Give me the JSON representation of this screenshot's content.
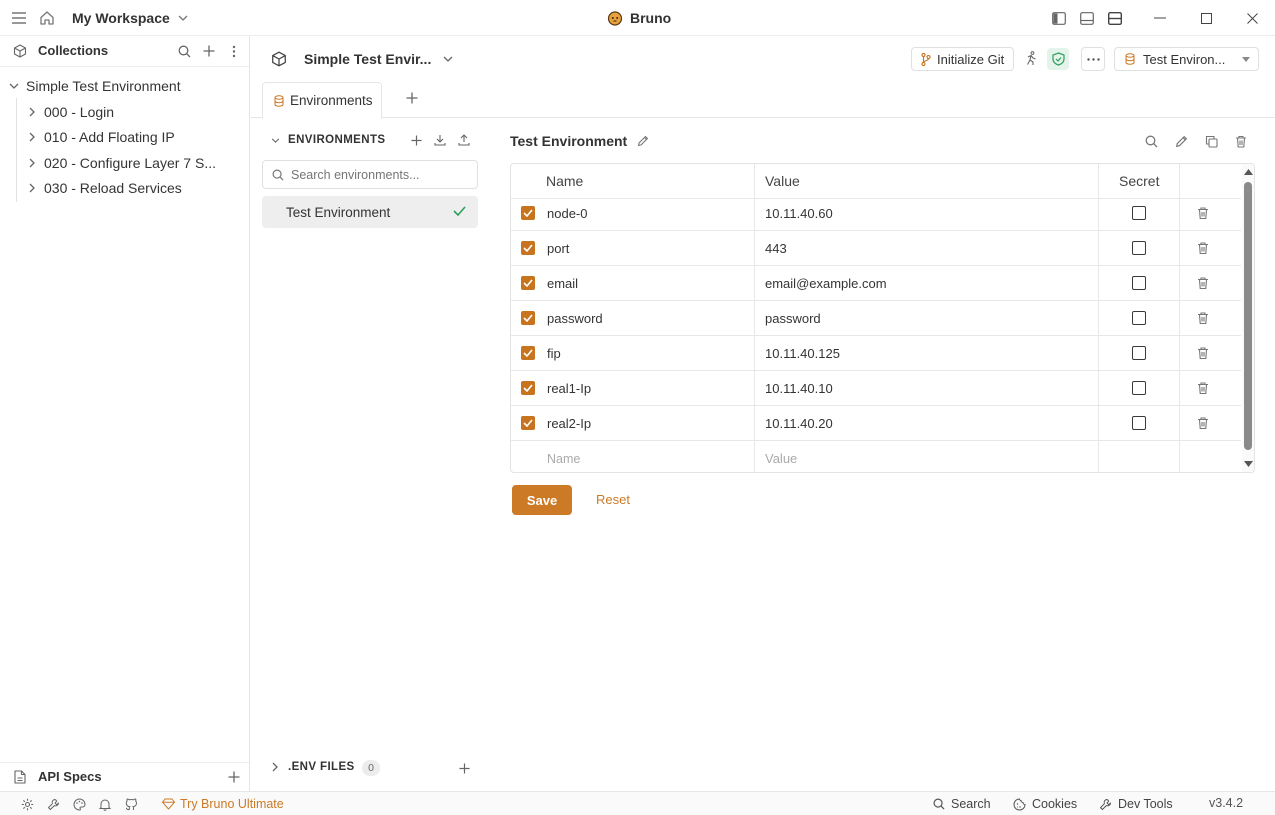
{
  "titlebar": {
    "workspace": "My Workspace",
    "app_title": "Bruno",
    "icons": [
      "menu-icon",
      "home-icon",
      "chevron-down-icon",
      "layout-left-icon",
      "layout-bottom-icon",
      "layout-split-icon",
      "minimize-icon",
      "maximize-icon",
      "close-icon"
    ]
  },
  "sidebar": {
    "collections_label": "Collections",
    "collection_name": "Simple Test Environment",
    "items": [
      {
        "label": "000 - Login"
      },
      {
        "label": "010 - Add Floating IP"
      },
      {
        "label": "020 - Configure Layer 7 S..."
      },
      {
        "label": "030 - Reload Services"
      }
    ],
    "api_specs_label": "API Specs"
  },
  "header": {
    "collection_title": "Simple Test Envir...",
    "init_git_label": "Initialize Git",
    "env_selector_label": "Test Environ..."
  },
  "tabs": [
    {
      "label": "Environments"
    }
  ],
  "environments_panel": {
    "heading": "ENVIRONMENTS",
    "search_placeholder": "Search environments...",
    "list": [
      {
        "label": "Test Environment",
        "active": true
      }
    ],
    "env_files_label": ".ENV FILES",
    "env_files_count": "0"
  },
  "env_detail": {
    "title": "Test Environment",
    "columns": {
      "name": "Name",
      "value": "Value",
      "secret": "Secret"
    },
    "rows": [
      {
        "name": "node-0",
        "value": "10.11.40.60",
        "enabled": true,
        "secret": false
      },
      {
        "name": "port",
        "value": "443",
        "enabled": true,
        "secret": false
      },
      {
        "name": "email",
        "value": "email@example.com",
        "enabled": true,
        "secret": false
      },
      {
        "name": "password",
        "value": "password",
        "enabled": true,
        "secret": false
      },
      {
        "name": "fip",
        "value": "10.11.40.125",
        "enabled": true,
        "secret": false
      },
      {
        "name": "real1-Ip",
        "value": "10.11.40.10",
        "enabled": true,
        "secret": false
      },
      {
        "name": "real2-Ip",
        "value": "10.11.40.20",
        "enabled": true,
        "secret": false
      }
    ],
    "new_row": {
      "name_placeholder": "Name",
      "value_placeholder": "Value"
    },
    "save_label": "Save",
    "reset_label": "Reset"
  },
  "statusbar": {
    "try_label": "Try Bruno Ultimate",
    "search_label": "Search",
    "cookies_label": "Cookies",
    "devtools_label": "Dev Tools",
    "version": "v3.4.2"
  },
  "colors": {
    "accent": "#cc7a25",
    "checkbox": "#c8741e",
    "success": "#2e9e5b"
  }
}
